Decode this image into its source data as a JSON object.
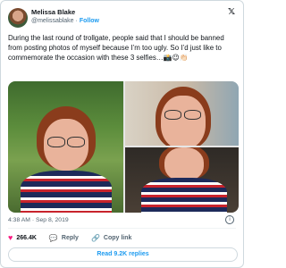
{
  "author": {
    "name": "Melissa Blake",
    "handle": "@melissablake",
    "separator": "·",
    "follow_label": "Follow"
  },
  "icons": {
    "brand": "x-logo-icon",
    "like": "heart-icon",
    "reply": "reply-icon",
    "copy": "link-icon",
    "info": "info-icon"
  },
  "tweet": {
    "text": "During the last round of trollgate, people said that I should be banned from posting photos of myself because I’m too ugly. So I’d just like to commemorate the occasion with these 3 selfies…📸😉👏🏻",
    "time": "4:38 AM · Sep 8, 2019"
  },
  "actions": {
    "likes": "266.4K",
    "reply_label": "Reply",
    "copy_label": "Copy link"
  },
  "read_replies_label": "Read 9.2K replies",
  "colors": {
    "accent": "#1d9bf0",
    "like": "#f91880",
    "secondary_text": "#536471"
  }
}
